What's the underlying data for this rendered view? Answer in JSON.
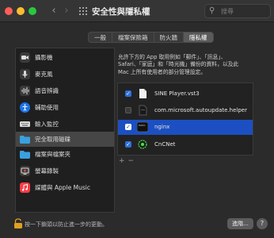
{
  "window": {
    "title": "安全性與隱私權",
    "search_placeholder": "搜尋"
  },
  "tabs": [
    {
      "label": "一般",
      "active": false
    },
    {
      "label": "檔案保險箱",
      "active": false
    },
    {
      "label": "防火牆",
      "active": false
    },
    {
      "label": "隱私權",
      "active": true
    }
  ],
  "sidebar": {
    "items": [
      {
        "label": "攝影機",
        "icon": "camera-icon",
        "color": "#3a3a3a"
      },
      {
        "label": "麥克風",
        "icon": "microphone-icon",
        "color": "#3a3a3a"
      },
      {
        "label": "語音辨識",
        "icon": "waveform-icon",
        "color": "#3a3a3a"
      },
      {
        "label": "輔助使用",
        "icon": "accessibility-icon",
        "color": "#1a73e8"
      },
      {
        "label": "輸入監控",
        "icon": "keyboard-icon",
        "color": "#d8d8d8"
      },
      {
        "label": "完全取用磁碟",
        "icon": "folder-icon",
        "color": "#3aa0e0",
        "selected": true
      },
      {
        "label": "檔案與檔案夾",
        "icon": "folder-icon",
        "color": "#3aa0e0"
      },
      {
        "label": "螢幕錄製",
        "icon": "screen-record-icon",
        "color": "#3a3a3a"
      },
      {
        "label": "媒體與 Apple Music",
        "icon": "music-icon",
        "color": "#fc3c44"
      }
    ]
  },
  "description": {
    "line1": "允許下方的 App 取用例如「郵件」、「訊息」、",
    "line2": "Safari、「家庭」和「時光機」備份的資料，以及此",
    "line3": "Mac 上所有使用者的部分管理設定。"
  },
  "apps": [
    {
      "label": "SINE Player.vst3",
      "checked": true,
      "icon": "document-icon"
    },
    {
      "label": "com.microsoft.autoupdate.helper",
      "checked": false,
      "icon": "document-icon"
    },
    {
      "label": "nginx",
      "checked": true,
      "icon": "terminal-icon",
      "selected": true
    },
    {
      "label": "CnCNet",
      "checked": true,
      "icon": "cncnet-icon"
    }
  ],
  "list_controls": {
    "add": "+",
    "remove": "−"
  },
  "footer": {
    "lock_text": "按一下鎖頭以防止進一步的更動。",
    "advanced_label": "進階...",
    "help_label": "?"
  },
  "colors": {
    "accent": "#2f6fdc",
    "selection": "#1c4fc1"
  }
}
